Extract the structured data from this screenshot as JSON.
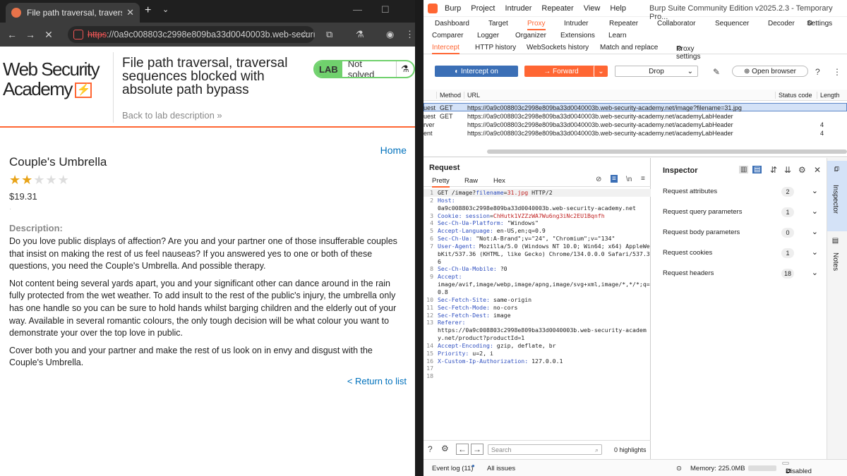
{
  "browser": {
    "tab_title": "File path traversal, traversal seq",
    "url_scheme": "https",
    "url_rest": "://0a9c008803c2998e809ba33d0040003b.web-securi..."
  },
  "lab": {
    "logo_line1": "Web Security",
    "logo_line2": "Academy",
    "title": "File path traversal, traversal sequences blocked with absolute path bypass",
    "back": "Back to lab description",
    "badge_lab": "LAB",
    "badge_status": "Not solved"
  },
  "product": {
    "home": "Home",
    "name": "Couple's Umbrella",
    "rating": 2,
    "rating_max": 5,
    "price": "$19.31",
    "desc_label": "Description:",
    "paragraphs": [
      "Do you love public displays of affection? Are you and your partner one of those insufferable couples that insist on making the rest of us feel nauseas? If you answered yes to one or both of these questions, you need the Couple's Umbrella. And possible therapy.",
      "Not content being several yards apart, you and your significant other can dance around in the rain fully protected from the wet weather. To add insult to the rest of the public's injury, the umbrella only has one handle so you can be sure to hold hands whilst barging children and the elderly out of your way. Available in several romantic colours, the only tough decision will be what colour you want to demonstrate your over the top love in public.",
      "Cover both you and your partner and make the rest of us look on in envy and disgust with the Couple's Umbrella."
    ],
    "return": "< Return to list"
  },
  "burp": {
    "menu": [
      "Burp",
      "Project",
      "Intruder",
      "Repeater",
      "View",
      "Help"
    ],
    "title": "Burp Suite Community Edition v2025.2.3 - Temporary Pro...",
    "tabs_row1": [
      "Dashboard",
      "Target",
      "Proxy",
      "Intruder",
      "Repeater",
      "Collaborator",
      "Sequencer",
      "Decoder"
    ],
    "settings": "Settings",
    "tabs_row2": [
      "Comparer",
      "Logger",
      "Organizer",
      "Extensions",
      "Learn"
    ],
    "subtabs": [
      "Intercept",
      "HTTP history",
      "WebSockets history",
      "Match and replace",
      "Proxy settings"
    ],
    "intercept_btn": "Intercept on",
    "forward_btn": "Forward",
    "drop_btn": "Drop",
    "open_browser": "Open browser",
    "table_headers": [
      "Method",
      "URL",
      "Status code",
      "Length"
    ],
    "rows": [
      {
        "type": "uest",
        "method": "GET",
        "url": "https://0a9c008803c2998e809ba33d0040003b.web-security-academy.net/image?filename=31.jpg",
        "status": "",
        "length": ""
      },
      {
        "type": "uest",
        "method": "GET",
        "url": "https://0a9c008803c2998e809ba33d0040003b.web-security-academy.net/academyLabHeader",
        "status": "",
        "length": ""
      },
      {
        "type": "rver",
        "method": "",
        "url": "https://0a9c008803c2998e809ba33d0040003b.web-security-academy.net/academyLabHeader",
        "status": "",
        "length": "4"
      },
      {
        "type": "ent",
        "method": "",
        "url": "https://0a9c008803c2998e809ba33d0040003b.web-security-academy.net/academyLabHeader",
        "status": "",
        "length": "4"
      }
    ],
    "request_title": "Request",
    "request_tabs": [
      "Pretty",
      "Raw",
      "Hex"
    ],
    "request_lines": [
      {
        "n": "1",
        "k": "",
        "v": "GET /image?",
        "p": "filename",
        "e": "=",
        "val": "31.jpg",
        "rest": " HTTP/2"
      },
      {
        "n": "2",
        "k": "Host:",
        "v": "",
        "rest": ""
      },
      {
        "n": "",
        "k": "",
        "v": "0a9c008803c2998e809ba33d0040003b.web-security-academy.net",
        "rest": ""
      },
      {
        "n": "3",
        "k": "Cookie:",
        "v": " ",
        "p": "session",
        "e": "=",
        "val": "ChHutk1VZZzWA7Wu6ng3iNc2EU1Bqnfh",
        "rest": ""
      },
      {
        "n": "4",
        "k": "Sec-Ch-Ua-Platform:",
        "v": " \"Windows\"",
        "rest": ""
      },
      {
        "n": "5",
        "k": "Accept-Language:",
        "v": " en-US,en;q=0.9",
        "rest": ""
      },
      {
        "n": "6",
        "k": "Sec-Ch-Ua:",
        "v": " \"Not:A-Brand\";v=\"24\", \"Chromium\";v=\"134\"",
        "rest": ""
      },
      {
        "n": "7",
        "k": "User-Agent:",
        "v": " Mozilla/5.0 (Windows NT 10.0; Win64; x64) AppleWebKit/537.36 (KHTML, like Gecko) Chrome/134.0.0.0 Safari/537.36",
        "rest": ""
      },
      {
        "n": "8",
        "k": "Sec-Ch-Ua-Mobile:",
        "v": " ?0",
        "rest": ""
      },
      {
        "n": "9",
        "k": "Accept:",
        "v": "",
        "rest": ""
      },
      {
        "n": "",
        "k": "",
        "v": "image/avif,image/webp,image/apng,image/svg+xml,image/*,*/*;q=0.8",
        "rest": ""
      },
      {
        "n": "10",
        "k": "Sec-Fetch-Site:",
        "v": " same-origin",
        "rest": ""
      },
      {
        "n": "11",
        "k": "Sec-Fetch-Mode:",
        "v": " no-cors",
        "rest": ""
      },
      {
        "n": "12",
        "k": "Sec-Fetch-Dest:",
        "v": " image",
        "rest": ""
      },
      {
        "n": "13",
        "k": "Referer:",
        "v": "",
        "rest": ""
      },
      {
        "n": "",
        "k": "",
        "v": "https://0a9c008803c2998e809ba33d0040003b.web-security-academy.net/product?productId=1",
        "rest": ""
      },
      {
        "n": "14",
        "k": "Accept-Encoding:",
        "v": " gzip, deflate, br",
        "rest": ""
      },
      {
        "n": "15",
        "k": "Priority:",
        "v": " u=2, i",
        "rest": ""
      },
      {
        "n": "16",
        "k": "X-Custom-Ip-Authorization:",
        "v": " 127.0.0.1",
        "rest": ""
      },
      {
        "n": "17",
        "k": "",
        "v": "",
        "rest": ""
      },
      {
        "n": "18",
        "k": "",
        "v": "",
        "rest": ""
      }
    ],
    "inspector_title": "Inspector",
    "inspector_rows": [
      {
        "label": "Request attributes",
        "count": "2"
      },
      {
        "label": "Request query parameters",
        "count": "1"
      },
      {
        "label": "Request body parameters",
        "count": "0"
      },
      {
        "label": "Request cookies",
        "count": "1"
      },
      {
        "label": "Request headers",
        "count": "18"
      }
    ],
    "side_tabs": [
      "Inspector",
      "Notes"
    ],
    "search_placeholder": "Search",
    "highlights": "0 highlights",
    "event_log": "Event log (11)",
    "all_issues": "All issues",
    "memory": "Memory: 225.0MB",
    "disabled": "Disabled"
  }
}
